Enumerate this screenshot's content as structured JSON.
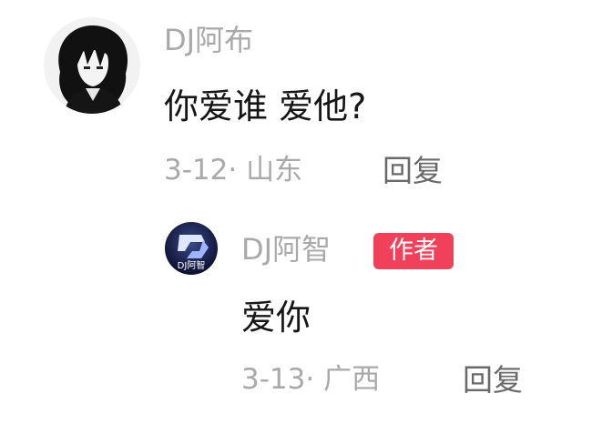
{
  "comment": {
    "username": "DJ阿布",
    "text": "你爱谁 爱他?",
    "date": "3-12",
    "location": "· 山东",
    "reply_label": "回复"
  },
  "reply": {
    "username": "DJ阿智",
    "badge": "作者",
    "avatar_logo": "DJ阿智",
    "text": "爱你",
    "date": "3-13",
    "location": "· 广西",
    "reply_label": "回复"
  },
  "colors": {
    "badge": "#f0405a",
    "meta_text": "#a9a9a9",
    "reply_action": "#6a6a6a",
    "body_text": "#161616"
  },
  "icons": {
    "comment_avatar": "anime-character-avatar",
    "reply_avatar": "dj-logo-avatar"
  }
}
